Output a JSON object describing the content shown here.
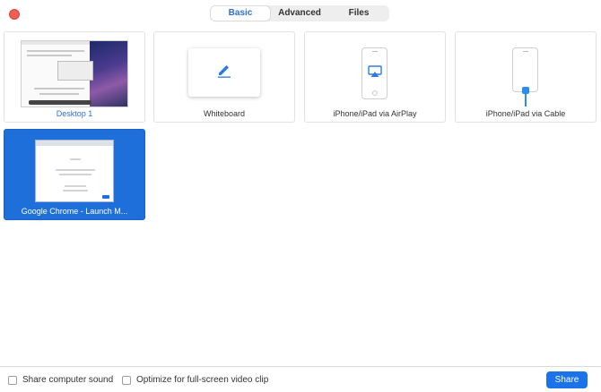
{
  "tabs": [
    {
      "label": "Basic",
      "active": true
    },
    {
      "label": "Advanced",
      "active": false
    },
    {
      "label": "Files",
      "active": false
    }
  ],
  "tiles": [
    {
      "label": "Desktop 1",
      "icon": "desktop-thumbnail-icon",
      "selected": false
    },
    {
      "label": "Whiteboard",
      "icon": "pencil-icon",
      "selected": false
    },
    {
      "label": "iPhone/iPad via AirPlay",
      "icon": "airplay-phone-icon",
      "selected": false
    },
    {
      "label": "iPhone/iPad via Cable",
      "icon": "cable-phone-icon",
      "selected": false
    },
    {
      "label": "Google Chrome - Launch M...",
      "icon": "chrome-window-thumbnail-icon",
      "selected": true
    }
  ],
  "footer": {
    "share_sound": "Share computer sound",
    "optimize_video": "Optimize for full-screen video clip",
    "share_button": "Share"
  },
  "colors": {
    "accent": "#1a73e8",
    "selected_tile": "#1f6fdb",
    "close": "#ec5f57"
  }
}
